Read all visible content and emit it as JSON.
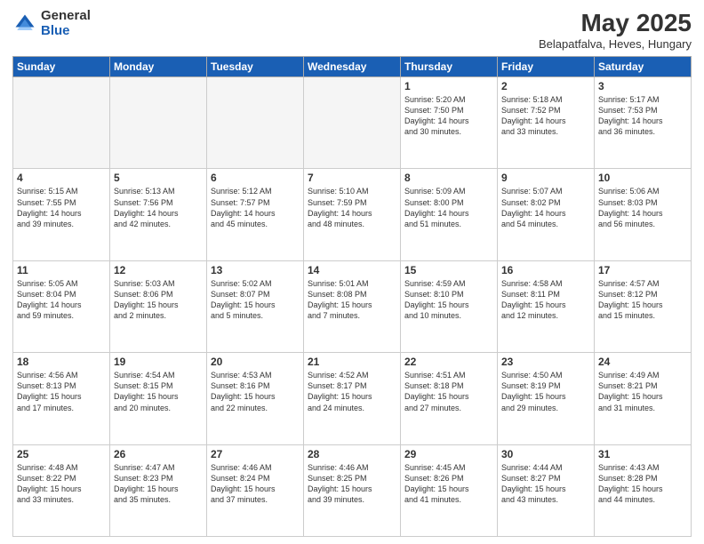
{
  "logo": {
    "general": "General",
    "blue": "Blue"
  },
  "title": "May 2025",
  "subtitle": "Belapatfalva, Heves, Hungary",
  "weekdays": [
    "Sunday",
    "Monday",
    "Tuesday",
    "Wednesday",
    "Thursday",
    "Friday",
    "Saturday"
  ],
  "weeks": [
    [
      {
        "day": "",
        "info": ""
      },
      {
        "day": "",
        "info": ""
      },
      {
        "day": "",
        "info": ""
      },
      {
        "day": "",
        "info": ""
      },
      {
        "day": "1",
        "info": "Sunrise: 5:20 AM\nSunset: 7:50 PM\nDaylight: 14 hours\nand 30 minutes."
      },
      {
        "day": "2",
        "info": "Sunrise: 5:18 AM\nSunset: 7:52 PM\nDaylight: 14 hours\nand 33 minutes."
      },
      {
        "day": "3",
        "info": "Sunrise: 5:17 AM\nSunset: 7:53 PM\nDaylight: 14 hours\nand 36 minutes."
      }
    ],
    [
      {
        "day": "4",
        "info": "Sunrise: 5:15 AM\nSunset: 7:55 PM\nDaylight: 14 hours\nand 39 minutes."
      },
      {
        "day": "5",
        "info": "Sunrise: 5:13 AM\nSunset: 7:56 PM\nDaylight: 14 hours\nand 42 minutes."
      },
      {
        "day": "6",
        "info": "Sunrise: 5:12 AM\nSunset: 7:57 PM\nDaylight: 14 hours\nand 45 minutes."
      },
      {
        "day": "7",
        "info": "Sunrise: 5:10 AM\nSunset: 7:59 PM\nDaylight: 14 hours\nand 48 minutes."
      },
      {
        "day": "8",
        "info": "Sunrise: 5:09 AM\nSunset: 8:00 PM\nDaylight: 14 hours\nand 51 minutes."
      },
      {
        "day": "9",
        "info": "Sunrise: 5:07 AM\nSunset: 8:02 PM\nDaylight: 14 hours\nand 54 minutes."
      },
      {
        "day": "10",
        "info": "Sunrise: 5:06 AM\nSunset: 8:03 PM\nDaylight: 14 hours\nand 56 minutes."
      }
    ],
    [
      {
        "day": "11",
        "info": "Sunrise: 5:05 AM\nSunset: 8:04 PM\nDaylight: 14 hours\nand 59 minutes."
      },
      {
        "day": "12",
        "info": "Sunrise: 5:03 AM\nSunset: 8:06 PM\nDaylight: 15 hours\nand 2 minutes."
      },
      {
        "day": "13",
        "info": "Sunrise: 5:02 AM\nSunset: 8:07 PM\nDaylight: 15 hours\nand 5 minutes."
      },
      {
        "day": "14",
        "info": "Sunrise: 5:01 AM\nSunset: 8:08 PM\nDaylight: 15 hours\nand 7 minutes."
      },
      {
        "day": "15",
        "info": "Sunrise: 4:59 AM\nSunset: 8:10 PM\nDaylight: 15 hours\nand 10 minutes."
      },
      {
        "day": "16",
        "info": "Sunrise: 4:58 AM\nSunset: 8:11 PM\nDaylight: 15 hours\nand 12 minutes."
      },
      {
        "day": "17",
        "info": "Sunrise: 4:57 AM\nSunset: 8:12 PM\nDaylight: 15 hours\nand 15 minutes."
      }
    ],
    [
      {
        "day": "18",
        "info": "Sunrise: 4:56 AM\nSunset: 8:13 PM\nDaylight: 15 hours\nand 17 minutes."
      },
      {
        "day": "19",
        "info": "Sunrise: 4:54 AM\nSunset: 8:15 PM\nDaylight: 15 hours\nand 20 minutes."
      },
      {
        "day": "20",
        "info": "Sunrise: 4:53 AM\nSunset: 8:16 PM\nDaylight: 15 hours\nand 22 minutes."
      },
      {
        "day": "21",
        "info": "Sunrise: 4:52 AM\nSunset: 8:17 PM\nDaylight: 15 hours\nand 24 minutes."
      },
      {
        "day": "22",
        "info": "Sunrise: 4:51 AM\nSunset: 8:18 PM\nDaylight: 15 hours\nand 27 minutes."
      },
      {
        "day": "23",
        "info": "Sunrise: 4:50 AM\nSunset: 8:19 PM\nDaylight: 15 hours\nand 29 minutes."
      },
      {
        "day": "24",
        "info": "Sunrise: 4:49 AM\nSunset: 8:21 PM\nDaylight: 15 hours\nand 31 minutes."
      }
    ],
    [
      {
        "day": "25",
        "info": "Sunrise: 4:48 AM\nSunset: 8:22 PM\nDaylight: 15 hours\nand 33 minutes."
      },
      {
        "day": "26",
        "info": "Sunrise: 4:47 AM\nSunset: 8:23 PM\nDaylight: 15 hours\nand 35 minutes."
      },
      {
        "day": "27",
        "info": "Sunrise: 4:46 AM\nSunset: 8:24 PM\nDaylight: 15 hours\nand 37 minutes."
      },
      {
        "day": "28",
        "info": "Sunrise: 4:46 AM\nSunset: 8:25 PM\nDaylight: 15 hours\nand 39 minutes."
      },
      {
        "day": "29",
        "info": "Sunrise: 4:45 AM\nSunset: 8:26 PM\nDaylight: 15 hours\nand 41 minutes."
      },
      {
        "day": "30",
        "info": "Sunrise: 4:44 AM\nSunset: 8:27 PM\nDaylight: 15 hours\nand 43 minutes."
      },
      {
        "day": "31",
        "info": "Sunrise: 4:43 AM\nSunset: 8:28 PM\nDaylight: 15 hours\nand 44 minutes."
      }
    ]
  ]
}
